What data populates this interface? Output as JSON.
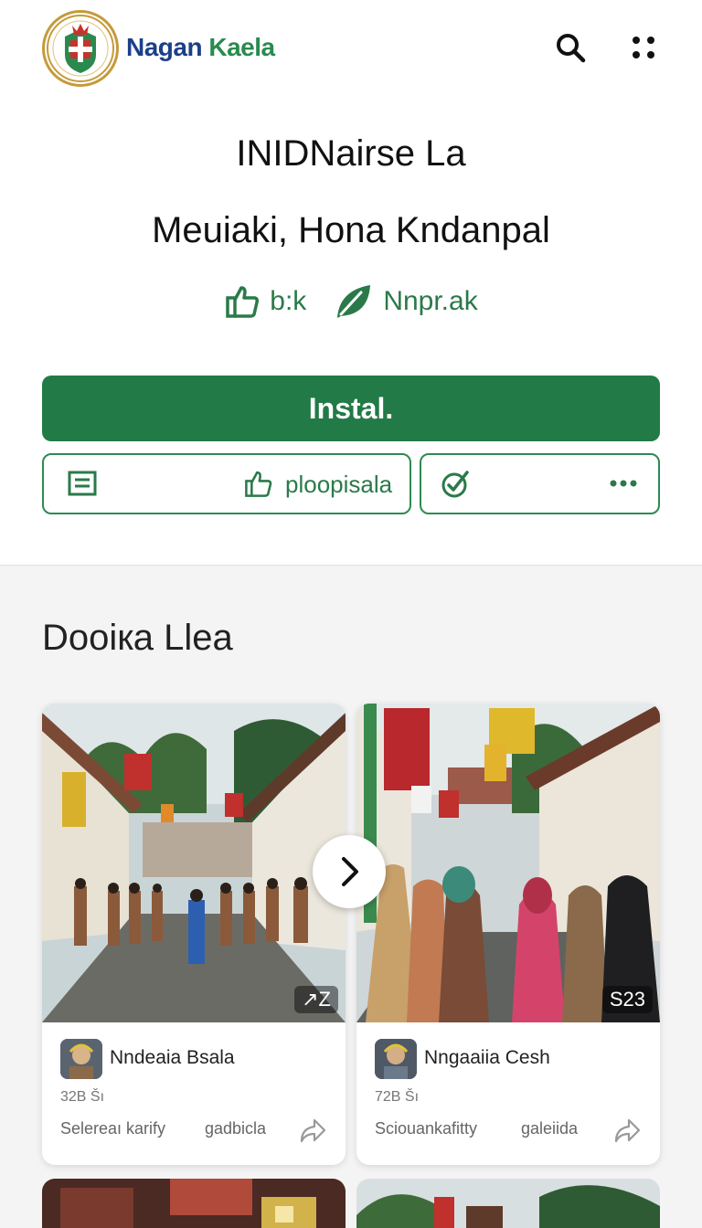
{
  "header": {
    "brand_part1": "Nagan",
    "brand_part2": "Kaela",
    "search_icon": "search-icon",
    "menu_icon": "grid-dots-icon"
  },
  "app": {
    "title_line1": "INIDNairse La",
    "title_line2": "Meuiaki, Hona Kndanpal",
    "stat_like_label": "b:k",
    "stat_leaf_label": "Nnpr.ak"
  },
  "actions": {
    "install_label": "Instal.",
    "like_action_label": "ploopisala",
    "list_icon": "list-icon",
    "like_icon": "thumbs-up-icon",
    "check_icon": "check-badge-icon",
    "more_icon": "more-dots-icon"
  },
  "section": {
    "title": "Dooiкa Llea"
  },
  "cards": [
    {
      "image_count": "↗Z",
      "author": "Nndeaia Bsala",
      "meta": "32B Šı",
      "footer_left": "Selereaı karify",
      "footer_right": "gadbicla"
    },
    {
      "image_count": "S23",
      "author": "Nngaaiia Cesh",
      "meta": "72B Šı",
      "footer_left": "Sciouankafitty",
      "footer_right": "galeiida"
    }
  ],
  "colors": {
    "brand_green": "#227a46",
    "brand_blue": "#1c3f8a",
    "logo_gold": "#c69a3b"
  }
}
